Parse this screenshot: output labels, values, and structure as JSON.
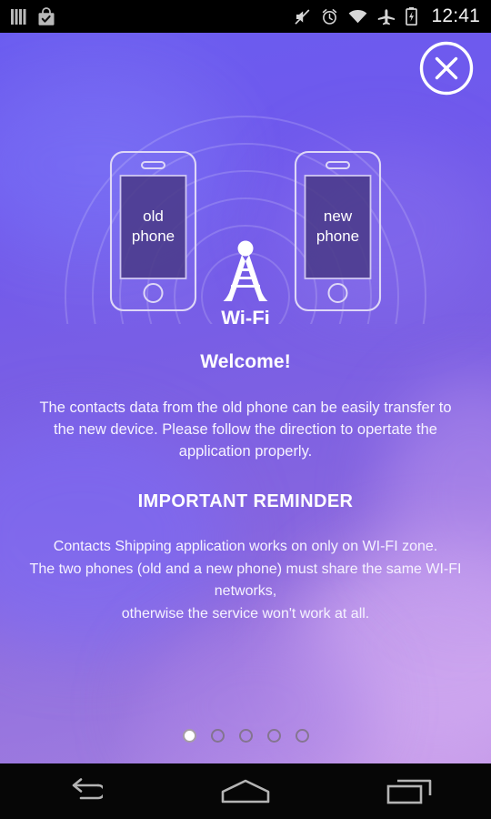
{
  "statusbar": {
    "time": "12:41",
    "left_icons": [
      {
        "name": "sim-bars-icon",
        "label": "signal bars"
      },
      {
        "name": "play-store-bag-icon",
        "label": "store update"
      }
    ],
    "right_icons": [
      {
        "name": "volume-mute-icon",
        "label": "muted"
      },
      {
        "name": "alarm-clock-icon",
        "label": "alarm set"
      },
      {
        "name": "wifi-icon",
        "label": "wifi connected"
      },
      {
        "name": "airplane-mode-icon",
        "label": "airplane mode"
      },
      {
        "name": "battery-charging-icon",
        "label": "battery charging"
      }
    ]
  },
  "header": {
    "close_label": "✕"
  },
  "hero": {
    "old_phone_line1": "old",
    "old_phone_line2": "phone",
    "new_phone_line1": "new",
    "new_phone_line2": "phone",
    "wifi_label": "Wi-Fi"
  },
  "content": {
    "welcome_title": "Welcome!",
    "intro_paragraph": "The contacts data from the old phone can be easily transfer to the new device. Please follow the direction to opertate the application properly.",
    "reminder_title": "IMPORTANT REMINDER",
    "reminder_line1": "Contacts Shipping application works on only on WI-FI zone.",
    "reminder_line2": "The two phones (old and a new phone) must share the same WI-FI networks,",
    "reminder_line3": "otherwise the service won't work at all."
  },
  "pager": {
    "total": 5,
    "current": 1,
    "dots": [
      {
        "index": 1,
        "active": true
      },
      {
        "index": 2,
        "active": false
      },
      {
        "index": 3,
        "active": false
      },
      {
        "index": 4,
        "active": false
      },
      {
        "index": 5,
        "active": false
      }
    ]
  },
  "navbar": {
    "back_label": "Back",
    "home_label": "Home",
    "recents_label": "Recent apps"
  },
  "colors": {
    "accent_purple": "#6a5cf0",
    "accent_lavender": "#ab86e0",
    "phone_screen": "#4a3a8a",
    "outline": "#ded7f7",
    "text_primary": "#ffffff",
    "statusbar_bg": "#000000",
    "navbar_bg": "#060606"
  }
}
